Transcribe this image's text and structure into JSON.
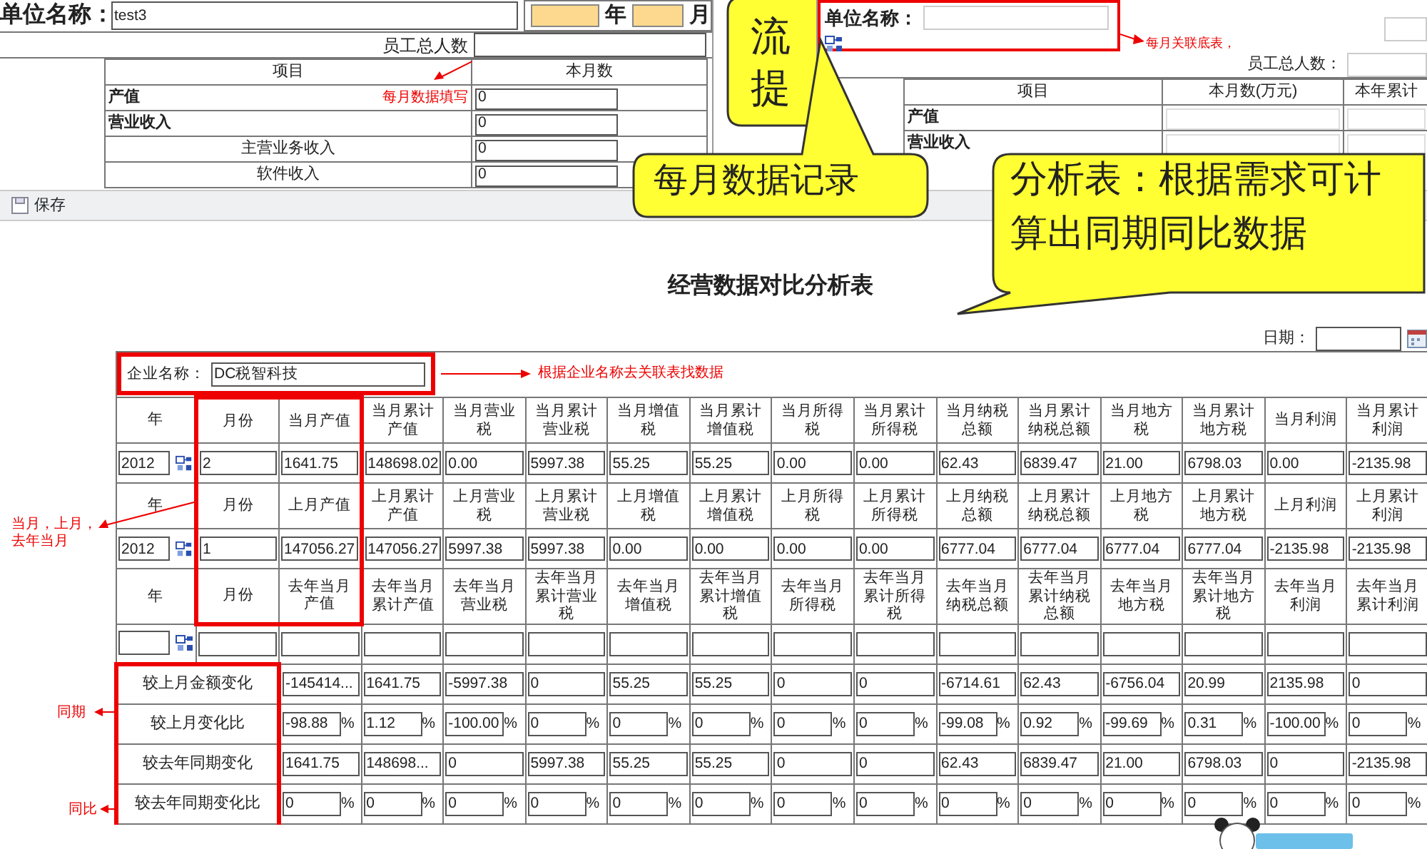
{
  "monthly_form": {
    "unit_label": "单位名称：",
    "unit_value": "test3",
    "year_label": "年",
    "month_label": "月",
    "staff_label": "员工总人数",
    "columns": [
      "项目",
      "本月数"
    ],
    "rows": [
      {
        "label": "产值",
        "kind": "item",
        "value": "0"
      },
      {
        "label": "营业收入",
        "kind": "item",
        "value": "0"
      },
      {
        "label": "主营业务收入",
        "kind": "subitem",
        "value": "0"
      },
      {
        "label": "软件收入",
        "kind": "subitem",
        "value": "0"
      }
    ],
    "annotation": "每月数据填写"
  },
  "linked_form": {
    "unit_label": "单位名称：",
    "note": "每月关联底表，",
    "staff_label": "员工总人数：",
    "columns": [
      "项目",
      "本月数(万元)",
      "本年累计"
    ],
    "rows": [
      {
        "label": "产值",
        "kind": "item"
      },
      {
        "label": "营业收入",
        "kind": "item"
      }
    ]
  },
  "callouts": [
    {
      "lines": [
        "流",
        "提"
      ]
    },
    {
      "lines": [
        "每月数据记录"
      ]
    },
    {
      "lines": [
        "分析表：根据需求可计",
        "算出同期同比数据"
      ]
    }
  ],
  "toolbar": {
    "save_label": "保存"
  },
  "report": {
    "title": "经营数据对比分析表",
    "date_label": "日期：",
    "company_label": "企业名称：",
    "company_value": "DC税智科技",
    "company_note": "根据企业名称去关联表找数据",
    "blocks": [
      {
        "headers": [
          "年",
          "月份",
          "当月产值",
          "当月累计产值",
          "当月营业税",
          "当月累计营业税",
          "当月增值税",
          "当月累计增值税",
          "当月所得税",
          "当月累计所得税",
          "当月纳税总额",
          "当月累计纳税总额",
          "当月地方税",
          "当月累计地方税",
          "当月利润",
          "当月累计利润"
        ],
        "year": "2012",
        "month": "2",
        "values": [
          "1641.75",
          "148698.02",
          "0.00",
          "5997.38",
          "55.25",
          "55.25",
          "0.00",
          "0.00",
          "62.43",
          "6839.47",
          "21.00",
          "6798.03",
          "0.00",
          "-2135.98"
        ]
      },
      {
        "headers": [
          "年",
          "月份",
          "上月产值",
          "上月累计产值",
          "上月营业税",
          "上月累计营业税",
          "上月增值税",
          "上月累计增值税",
          "上月所得税",
          "上月累计所得税",
          "上月纳税总额",
          "上月累计纳税总额",
          "上月地方税",
          "上月累计地方税",
          "上月利润",
          "上月累计利润"
        ],
        "year": "2012",
        "month": "1",
        "values": [
          "147056.27",
          "147056.27",
          "5997.38",
          "5997.38",
          "0.00",
          "0.00",
          "0.00",
          "0.00",
          "6777.04",
          "6777.04",
          "6777.04",
          "6777.04",
          "-2135.98",
          "-2135.98"
        ]
      },
      {
        "headers": [
          "年",
          "月份",
          "去年当月产值",
          "去年当月累计产值",
          "去年当月营业税",
          "去年当月累计营业税",
          "去年当月增值税",
          "去年当月累计增值税",
          "去年当月所得税",
          "去年当月累计所得税",
          "去年当月纳税总额",
          "去年当月累计纳税总额",
          "去年当月地方税",
          "去年当月累计地方税",
          "去年当月利润",
          "去年当月累计利润"
        ]
      }
    ],
    "compare_rows": [
      {
        "label": "较上月金额变化",
        "kind": "amount",
        "values": [
          "-145414...",
          "1641.75",
          "-5997.38",
          "0",
          "55.25",
          "55.25",
          "0",
          "0",
          "-6714.61",
          "62.43",
          "-6756.04",
          "20.99",
          "2135.98",
          "0"
        ]
      },
      {
        "label": "较上月变化比",
        "kind": "ratio",
        "values": [
          {
            "value": "-98.88",
            "unit": "%"
          },
          {
            "value": "1.12",
            "unit": "%"
          },
          {
            "value": "-100.00",
            "unit": "%"
          },
          {
            "value": "0",
            "unit": "%"
          },
          {
            "value": "0",
            "unit": "%"
          },
          {
            "value": "0",
            "unit": "%"
          },
          {
            "value": "0",
            "unit": "%"
          },
          {
            "value": "0",
            "unit": "%"
          },
          {
            "value": "-99.08",
            "unit": "%"
          },
          {
            "value": "0.92",
            "unit": "%"
          },
          {
            "value": "-99.69",
            "unit": "%"
          },
          {
            "value": "0.31",
            "unit": "%"
          },
          {
            "value": "-100.00",
            "unit": "%"
          },
          {
            "value": "0",
            "unit": "%"
          }
        ]
      },
      {
        "label": "较去年同期变化",
        "kind": "amount",
        "values": [
          "1641.75",
          "148698...",
          "0",
          "5997.38",
          "55.25",
          "55.25",
          "0",
          "0",
          "62.43",
          "6839.47",
          "21.00",
          "6798.03",
          "0",
          "-2135.98"
        ]
      },
      {
        "label": "较去年同期变化比",
        "kind": "ratio",
        "values": [
          {
            "value": "0",
            "unit": "%"
          },
          {
            "value": "0",
            "unit": "%"
          },
          {
            "value": "0",
            "unit": "%"
          },
          {
            "value": "0",
            "unit": "%"
          },
          {
            "value": "0",
            "unit": "%"
          },
          {
            "value": "0",
            "unit": "%"
          },
          {
            "value": "0",
            "unit": "%"
          },
          {
            "value": "0",
            "unit": "%"
          },
          {
            "value": "0",
            "unit": "%"
          },
          {
            "value": "0",
            "unit": "%"
          },
          {
            "value": "0",
            "unit": "%"
          },
          {
            "value": "0",
            "unit": "%"
          },
          {
            "value": "0",
            "unit": "%"
          },
          {
            "value": "0",
            "unit": "%"
          }
        ]
      }
    ]
  },
  "side_notes": [
    "当月，上月，去年当月",
    "同期",
    "同比"
  ]
}
